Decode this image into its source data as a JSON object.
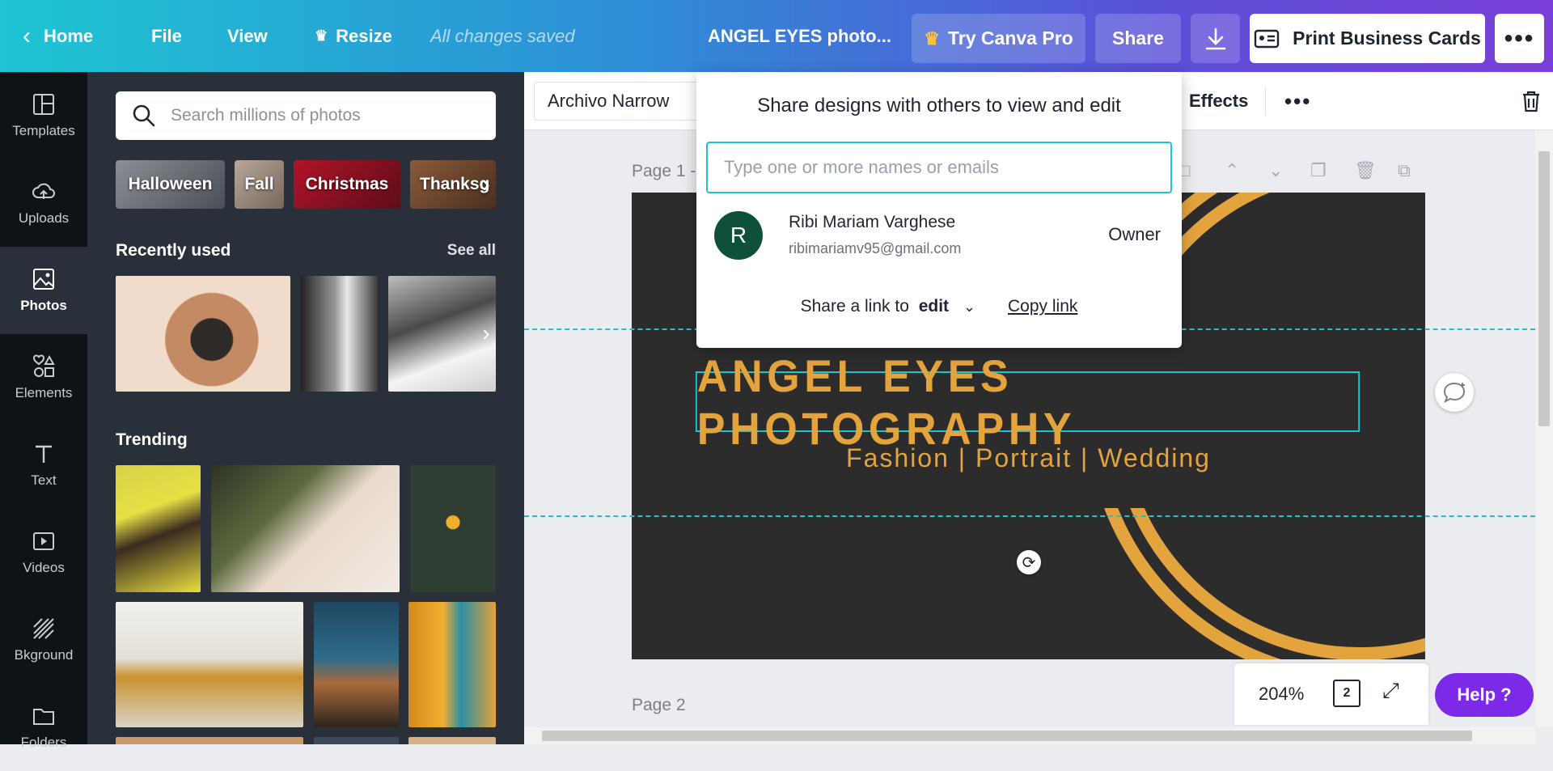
{
  "topbar": {
    "home": "Home",
    "file": "File",
    "view": "View",
    "resize": "Resize",
    "status": "All changes saved",
    "doc_title": "ANGEL EYES photo...",
    "try_pro": "Try Canva Pro",
    "share": "Share",
    "print": "Print Business Cards",
    "accent": "#7d2ae8"
  },
  "rail": {
    "items": [
      {
        "label": "Templates",
        "icon": "templates-icon"
      },
      {
        "label": "Uploads",
        "icon": "upload-cloud-icon"
      },
      {
        "label": "Photos",
        "icon": "photo-icon"
      },
      {
        "label": "Elements",
        "icon": "shapes-icon"
      },
      {
        "label": "Text",
        "icon": "text-icon"
      },
      {
        "label": "Videos",
        "icon": "video-icon"
      },
      {
        "label": "Bkground",
        "icon": "stripes-icon"
      },
      {
        "label": "Folders",
        "icon": "folder-icon"
      }
    ],
    "active": "Photos"
  },
  "panel": {
    "search_placeholder": "Search millions of photos",
    "chips": [
      "Halloween",
      "Fall",
      "Christmas",
      "Thanksg"
    ],
    "recently_used": "Recently used",
    "see_all": "See all",
    "trending": "Trending"
  },
  "toolbar": {
    "font": "Archivo Narrow",
    "effects": "Effects"
  },
  "canvas": {
    "page1_label": "Page 1 -",
    "page2_label": "Page 2",
    "headline": "ANGEL EYES PHOTOGRAPHY",
    "subline": "Fashion | Portrait | Wedding",
    "design_bg": "#2c2c2c",
    "design_accent": "#e3a33d"
  },
  "share_popover": {
    "title": "Share designs with others to view and edit",
    "input_placeholder": "Type one or more names or emails",
    "owner_initial": "R",
    "owner_name": "Ribi Mariam Varghese",
    "owner_email": "ribimariamv95@gmail.com",
    "owner_role": "Owner",
    "link_prefix": "Share a link to",
    "link_mode": "edit",
    "copy_link": "Copy link"
  },
  "bottom": {
    "zoom": "204%",
    "page_count": "2",
    "help": "Help ?"
  }
}
